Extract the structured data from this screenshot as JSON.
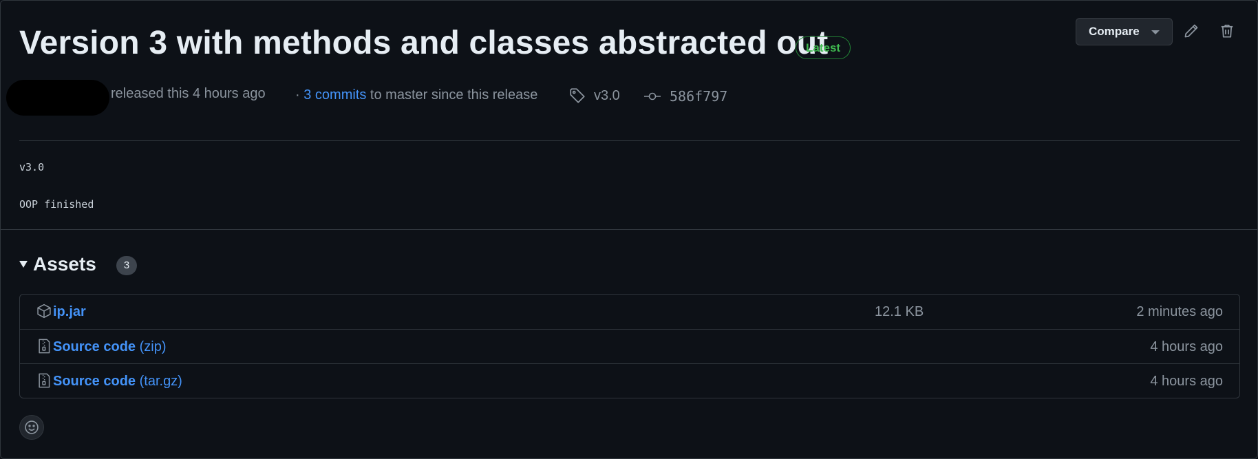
{
  "release": {
    "title": "Version 3 with methods and classes abstracted out",
    "badge": "Latest",
    "released_text": "released this 4 hours ago",
    "commits_prefix": "·",
    "commits_link": "3 commits",
    "commits_suffix": "to master since this release",
    "tag": "v3.0",
    "commit_sha": "586f797"
  },
  "toolbar": {
    "compare_label": "Compare",
    "edit_icon": "pencil-icon",
    "delete_icon": "trash-icon"
  },
  "body": {
    "line1": "v3.0",
    "line2": "OOP finished"
  },
  "assets": {
    "heading": "Assets",
    "count": "3",
    "items": [
      {
        "name": "ip.jar",
        "suffix": "",
        "size": "12.1 KB",
        "time": "2 minutes ago",
        "icon": "package-icon"
      },
      {
        "name": "Source code",
        "suffix": "(zip)",
        "size": "",
        "time": "4 hours ago",
        "icon": "file-zip-icon"
      },
      {
        "name": "Source code",
        "suffix": "(tar.gz)",
        "size": "",
        "time": "4 hours ago",
        "icon": "file-zip-icon"
      }
    ]
  },
  "colors": {
    "background": "#0d1117",
    "link": "#4493f8",
    "badge_green": "#3fb950",
    "muted": "#8b949e"
  }
}
